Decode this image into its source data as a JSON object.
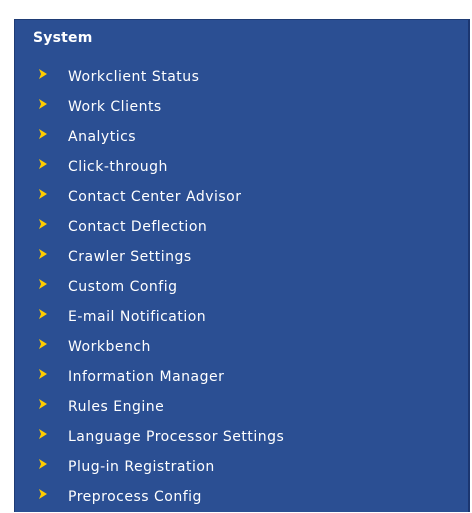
{
  "nav": {
    "section_title": "System",
    "accent_color": "#ffcc00",
    "panel_color": "#2b4f93",
    "items": [
      {
        "label": "Workclient Status",
        "icon": "chevron-right-icon"
      },
      {
        "label": "Work Clients",
        "icon": "chevron-right-icon"
      },
      {
        "label": "Analytics",
        "icon": "chevron-right-icon"
      },
      {
        "label": "Click-through",
        "icon": "chevron-right-icon"
      },
      {
        "label": "Contact Center Advisor",
        "icon": "chevron-right-icon"
      },
      {
        "label": "Contact Deflection",
        "icon": "chevron-right-icon"
      },
      {
        "label": "Crawler Settings",
        "icon": "chevron-right-icon"
      },
      {
        "label": "Custom Config",
        "icon": "chevron-right-icon"
      },
      {
        "label": "E-mail Notification",
        "icon": "chevron-right-icon"
      },
      {
        "label": "Workbench",
        "icon": "chevron-right-icon"
      },
      {
        "label": "Information Manager",
        "icon": "chevron-right-icon"
      },
      {
        "label": "Rules Engine",
        "icon": "chevron-right-icon"
      },
      {
        "label": "Language Processor Settings",
        "icon": "chevron-right-icon"
      },
      {
        "label": "Plug-in Registration",
        "icon": "chevron-right-icon"
      },
      {
        "label": "Preprocess Config",
        "icon": "chevron-right-icon"
      }
    ]
  }
}
